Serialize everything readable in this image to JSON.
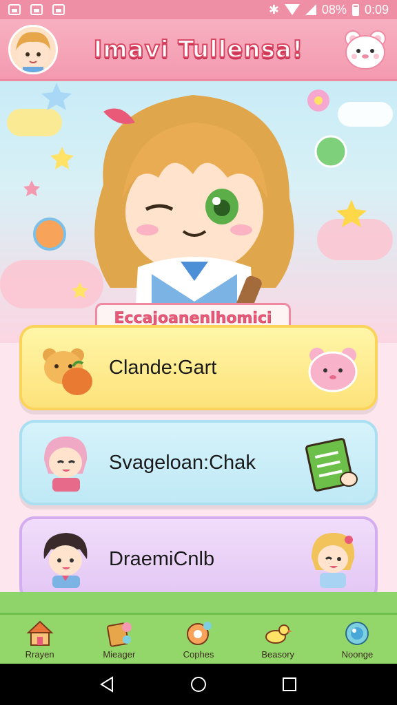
{
  "status_bar": {
    "battery": "08%",
    "time": "0:09"
  },
  "header": {
    "title": "Imavi Tullensa!"
  },
  "hero": {
    "banner": "Eccajoanenlhomici"
  },
  "cards": [
    {
      "label": "Clande:Gart",
      "left_icon": "bear-peach-icon",
      "right_icon": "pink-bear-icon",
      "color": "#fde27a"
    },
    {
      "label": "Svageloan:Chak",
      "left_icon": "pink-hair-girl-icon",
      "right_icon": "notebook-icon",
      "color": "#bfe9f5"
    },
    {
      "label": "DraemiCnlb",
      "left_icon": "dark-hair-boy-icon",
      "right_icon": "blonde-girl-icon",
      "color": "#e2c6f4"
    }
  ],
  "bottom_nav": [
    {
      "label": "Rrayen",
      "icon": "house-icon"
    },
    {
      "label": "Mieager",
      "icon": "clipboard-icon"
    },
    {
      "label": "Cophes",
      "icon": "chat-bubble-icon"
    },
    {
      "label": "Beasory",
      "icon": "bird-icon"
    },
    {
      "label": "Noonge",
      "icon": "globe-icon"
    }
  ],
  "colors": {
    "header": "#f49ab0",
    "accent": "#e85a77",
    "nav": "#93d66a"
  }
}
